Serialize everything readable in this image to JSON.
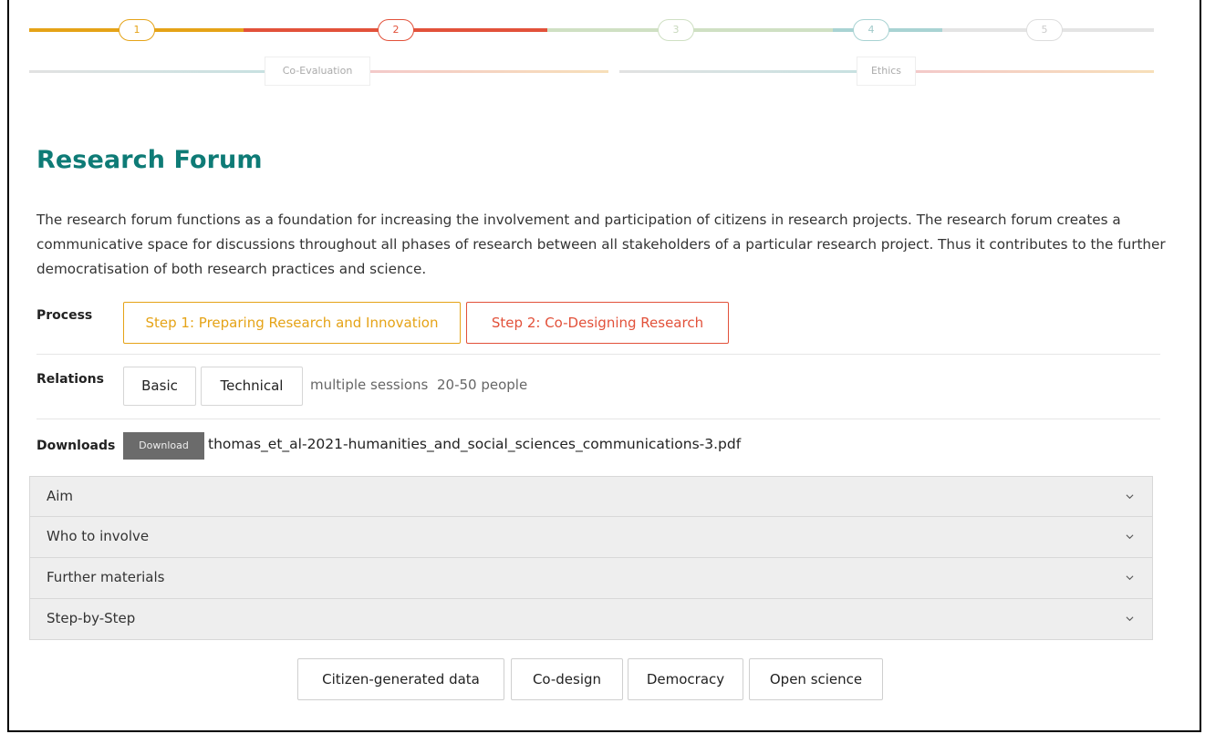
{
  "stepper": {
    "steps": [
      {
        "number": "1",
        "color": "#e5a317"
      },
      {
        "number": "2",
        "color": "#e2513a"
      },
      {
        "number": "3",
        "color": "#cfe0c3"
      },
      {
        "number": "4",
        "color": "#a9d3d3"
      },
      {
        "number": "5",
        "color": "#dddddd"
      }
    ],
    "active_step": "2",
    "phases": [
      "Co-Evaluation",
      "Ethics"
    ]
  },
  "page": {
    "title": "Research Forum",
    "description": "The  research forum functions as a foundation for increasing the involvement and participation of citizens in research projects. The research forum creates a communicative space for discussions throughout all phases of research between all stakeholders of a particular research project. Thus it contributes to the further democratisation of both research practices and science."
  },
  "process": {
    "label": "Process",
    "steps": [
      {
        "label": "Step 1: Preparing Research and Innovation",
        "color": "#e5a317"
      },
      {
        "label": "Step 2: Co-Designing Research",
        "color": "#e2513a"
      }
    ]
  },
  "relations": {
    "label": "Relations",
    "tags": [
      "Basic",
      "Technical"
    ],
    "sessions": "multiple sessions",
    "people": "20-50 people"
  },
  "downloads": {
    "label": "Downloads",
    "button_label": "Download",
    "filename": "thomas_et_al-2021-humanities_and_social_sciences_communications-3.pdf"
  },
  "accordion": [
    "Aim",
    "Who to involve",
    "Further materials",
    "Step-by-Step"
  ],
  "keywords": [
    "Citizen-generated data",
    "Co-design",
    "Democracy",
    "Open science"
  ],
  "icons": {
    "accordion_toggle": "chevron-down-icon"
  }
}
